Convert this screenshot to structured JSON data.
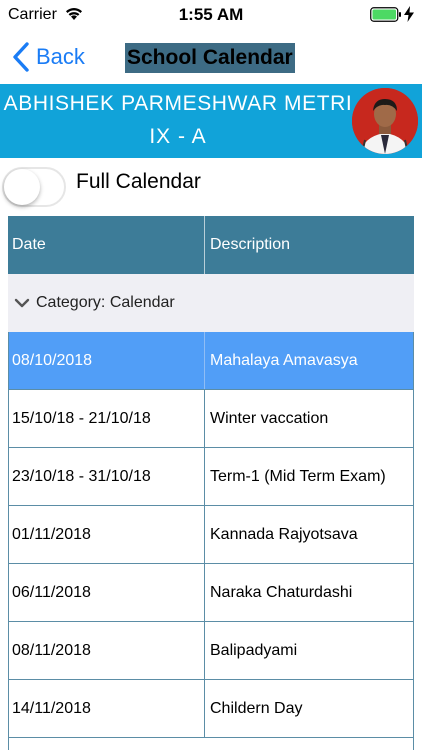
{
  "status_bar": {
    "carrier": "Carrier",
    "time": "1:55 AM",
    "battery_color": "#4cd964"
  },
  "nav": {
    "back_label": "Back",
    "title": "School Calendar",
    "accent": "#1a7cf5"
  },
  "student": {
    "name": "ABHISHEK PARMESHWAR METRI",
    "class": "IX - A"
  },
  "toggle": {
    "label": "Full Calendar",
    "on": false
  },
  "table": {
    "headers": {
      "date": "Date",
      "description": "Description"
    },
    "header_color": "#3d7c98",
    "category": "Category: Calendar",
    "rows": [
      {
        "date": "08/10/2018",
        "description": "Mahalaya Amavasya",
        "selected": true
      },
      {
        "date": "15/10/18 - 21/10/18",
        "description": "Winter vaccation",
        "selected": false
      },
      {
        "date": "23/10/18 - 31/10/18",
        "description": "Term-1 (Mid Term Exam)",
        "selected": false
      },
      {
        "date": "01/11/2018",
        "description": "Kannada Rajyotsava",
        "selected": false
      },
      {
        "date": "06/11/2018",
        "description": "Naraka Chaturdashi",
        "selected": false
      },
      {
        "date": "08/11/2018",
        "description": "Balipadyami",
        "selected": false
      },
      {
        "date": "14/11/2018",
        "description": "Childern Day",
        "selected": false
      }
    ]
  }
}
